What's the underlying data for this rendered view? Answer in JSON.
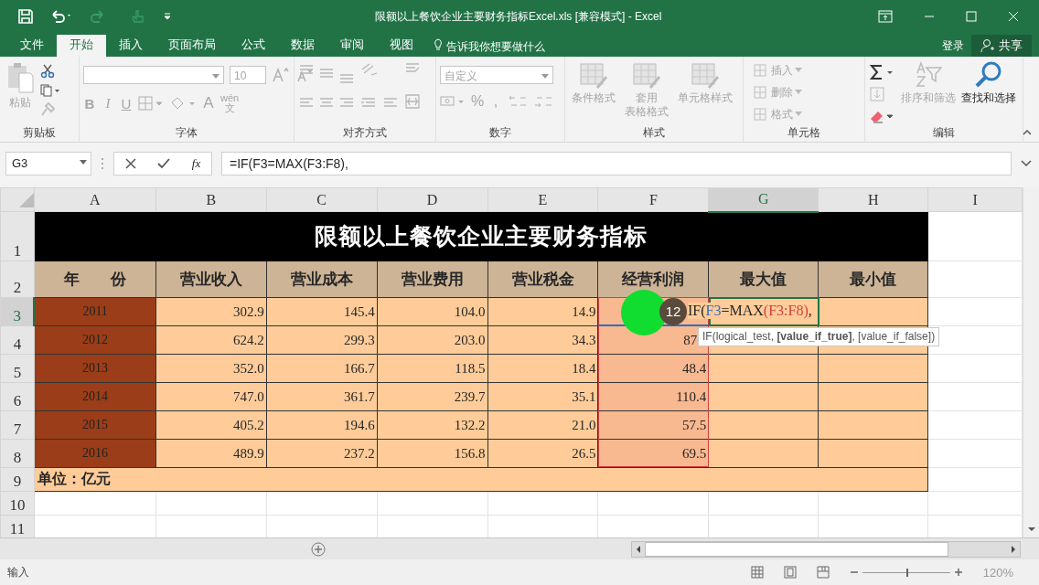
{
  "title_bar": {
    "title": "限额以上餐饮企业主要财务指标Excel.xls  [兼容模式] - Excel"
  },
  "menu_tabs": [
    {
      "label": "文件",
      "selected": false
    },
    {
      "label": "开始",
      "selected": true
    },
    {
      "label": "插入",
      "selected": false
    },
    {
      "label": "页面布局",
      "selected": false
    },
    {
      "label": "公式",
      "selected": false
    },
    {
      "label": "数据",
      "selected": false
    },
    {
      "label": "审阅",
      "selected": false
    },
    {
      "label": "视图",
      "selected": false
    }
  ],
  "tell_me": "告诉我你想要做什么",
  "sign_in": "登录",
  "share": "共享",
  "ribbon": [
    {
      "kind": "clipboard",
      "label": "剪贴板",
      "paste": {
        "label": "粘贴",
        "disabled": true
      }
    },
    {
      "kind": "font",
      "label": "字体",
      "size": "10",
      "bold": "B",
      "italic": "I",
      "underline": "U",
      "font_color": "A",
      "phonetic": [
        "wén",
        "文"
      ],
      "disabled": true
    },
    {
      "kind": "alignment",
      "label": "对齐方式",
      "disabled": true
    },
    {
      "kind": "number",
      "label": "数字",
      "format": "自定义",
      "percent": "%",
      "comma": ",",
      "disabled": true
    },
    {
      "kind": "styles",
      "label": "样式",
      "buttons": [
        {
          "label": "条件格式",
          "disabled": true
        },
        {
          "label_lines": [
            "套用",
            "表格格式"
          ],
          "disabled": true
        },
        {
          "label": "单元格样式",
          "disabled": true
        }
      ]
    },
    {
      "kind": "cells",
      "label": "单元格",
      "buttons": [
        {
          "label": "插入",
          "disabled": true
        },
        {
          "label": "删除",
          "disabled": true
        },
        {
          "label": "格式",
          "disabled": true
        }
      ]
    },
    {
      "kind": "editing",
      "label": "编辑",
      "buttons": [
        {
          "label": "排序和筛选",
          "disabled": true
        },
        {
          "label": "查找和选择",
          "disabled": false
        }
      ]
    }
  ],
  "formula_bar": {
    "name_box": "G3",
    "fx": "fx",
    "formula": "=IF(F3=MAX(F3:F8),"
  },
  "columns": [
    {
      "label": "A",
      "selected": false
    },
    {
      "label": "B",
      "selected": false
    },
    {
      "label": "C",
      "selected": false
    },
    {
      "label": "D",
      "selected": false
    },
    {
      "label": "E",
      "selected": false
    },
    {
      "label": "F",
      "selected": false
    },
    {
      "label": "G",
      "selected": true
    },
    {
      "label": "H",
      "selected": false
    },
    {
      "label": "I",
      "selected": false
    }
  ],
  "row_numbers": [
    {
      "label": "1",
      "selected": false
    },
    {
      "label": "2",
      "selected": false
    },
    {
      "label": "3",
      "selected": true
    },
    {
      "label": "4",
      "selected": false
    },
    {
      "label": "5",
      "selected": false
    },
    {
      "label": "6",
      "selected": false
    },
    {
      "label": "7",
      "selected": false
    },
    {
      "label": "8",
      "selected": false
    },
    {
      "label": "9",
      "selected": false
    },
    {
      "label": "10",
      "selected": false
    },
    {
      "label": "11",
      "selected": false
    }
  ],
  "sheet": {
    "title": "限额以上餐饮企业主要财务指标",
    "headers": [
      "年　　份",
      "营业收入",
      "营业成本",
      "营业费用",
      "营业税金",
      "经营利润",
      "最大值",
      "最小值"
    ],
    "rows": [
      {
        "year": "2011",
        "values": [
          "302.9",
          "145.4",
          "104.0",
          "14.9"
        ]
      },
      {
        "year": "2012",
        "values": [
          "624.2",
          "299.3",
          "203.0",
          "34.3"
        ],
        "profit": "87"
      },
      {
        "year": "2013",
        "values": [
          "352.0",
          "166.7",
          "118.5",
          "18.4"
        ],
        "profit": "48.4"
      },
      {
        "year": "2014",
        "values": [
          "747.0",
          "361.7",
          "239.7",
          "35.1"
        ],
        "profit": "110.4"
      },
      {
        "year": "2015",
        "values": [
          "405.2",
          "194.6",
          "132.2",
          "21.0"
        ],
        "profit": "57.5"
      },
      {
        "year": "2016",
        "values": [
          "489.9",
          "237.2",
          "156.8",
          "26.5"
        ],
        "profit": "69.5"
      }
    ],
    "unit_note": "单位：亿元",
    "editing_formula": [
      {
        "text": "IF("
      },
      {
        "text": "F3",
        "color": "#2f6fc0"
      },
      {
        "text": "=MAX"
      },
      {
        "text": "(F3:F8)",
        "color": "#d04040"
      },
      {
        "text": ","
      }
    ],
    "step_badge": "12",
    "tooltip": "IF(logical_test, **[value_if_true]**, [value_if_false])"
  },
  "status_bar": {
    "mode": "输入",
    "zoom": "120%",
    "zoom_slider": {
      "level": 0.5
    }
  }
}
